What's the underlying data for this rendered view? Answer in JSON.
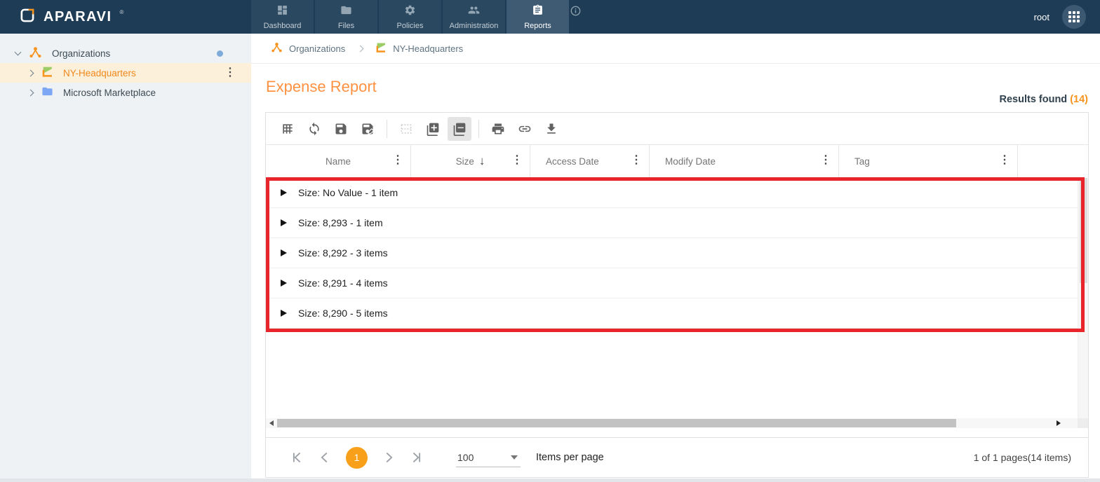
{
  "nav": {
    "brand": "APARAVI",
    "brand_mark": "®",
    "tabs": [
      {
        "label": "Dashboard",
        "icon": "dashboard-icon",
        "active": false
      },
      {
        "label": "Files",
        "icon": "folder-icon",
        "active": false
      },
      {
        "label": "Policies",
        "icon": "gear-icon",
        "active": false
      },
      {
        "label": "Administration",
        "icon": "people-icon",
        "active": false
      },
      {
        "label": "Reports",
        "icon": "clipboard-icon",
        "active": true
      }
    ],
    "info_icon": "info-icon",
    "user": "root",
    "apps_icon": "grid-apps-icon"
  },
  "sidebar": {
    "items": [
      {
        "label": "Organizations",
        "icon": "org-node-icon",
        "expanded": true,
        "selected": false,
        "has_blue_dot": true
      },
      {
        "label": "NY-Headquarters",
        "icon": "aggregator-flag-icon",
        "expanded": false,
        "selected": true,
        "has_menu": true
      },
      {
        "label": "Microsoft Marketplace",
        "icon": "folder-blue-icon",
        "expanded": false,
        "selected": false
      }
    ]
  },
  "breadcrumb": {
    "items": [
      {
        "label": "Organizations",
        "icon": "org-node-icon"
      },
      {
        "label": "NY-Headquarters",
        "icon": "aggregator-flag-icon"
      }
    ]
  },
  "page": {
    "title": "Expense Report",
    "results_label": "Results found",
    "results_count": "(14)"
  },
  "toolbar": {
    "icons": [
      "table-view",
      "refresh",
      "save",
      "save-edit",
      "split-view",
      "expand-all",
      "collapse-all",
      "print",
      "link",
      "download"
    ],
    "active_icon": "collapse-all",
    "disabled_icon": "split-view"
  },
  "table": {
    "columns": [
      {
        "label": "Name",
        "menu": true
      },
      {
        "label": "Size",
        "menu": true,
        "sorted": "desc"
      },
      {
        "label": "Access Date",
        "menu": true
      },
      {
        "label": "Modify Date",
        "menu": true
      },
      {
        "label": "Tag",
        "menu": true
      }
    ],
    "sort_arrow": "↓",
    "groups": [
      {
        "label": "Size: No Value - 1 item"
      },
      {
        "label": "Size: 8,293 - 1 item"
      },
      {
        "label": "Size: 8,292 - 3 items"
      },
      {
        "label": "Size: 8,291 - 4 items"
      },
      {
        "label": "Size: 8,290 - 5 items"
      }
    ],
    "highlight_color": "#e8252a"
  },
  "pagination": {
    "current_page": "1",
    "page_size": "100",
    "items_per_page_label": "Items per page",
    "summary": "1 of 1 pages(14 items)"
  },
  "colors": {
    "navy": "#1e3c55",
    "accent_orange": "#f7941e",
    "title_orange": "#ff9142",
    "selected_row_bg": "#fdf0da",
    "page_circle": "#f9a01b",
    "highlight_red": "#e8252a"
  }
}
